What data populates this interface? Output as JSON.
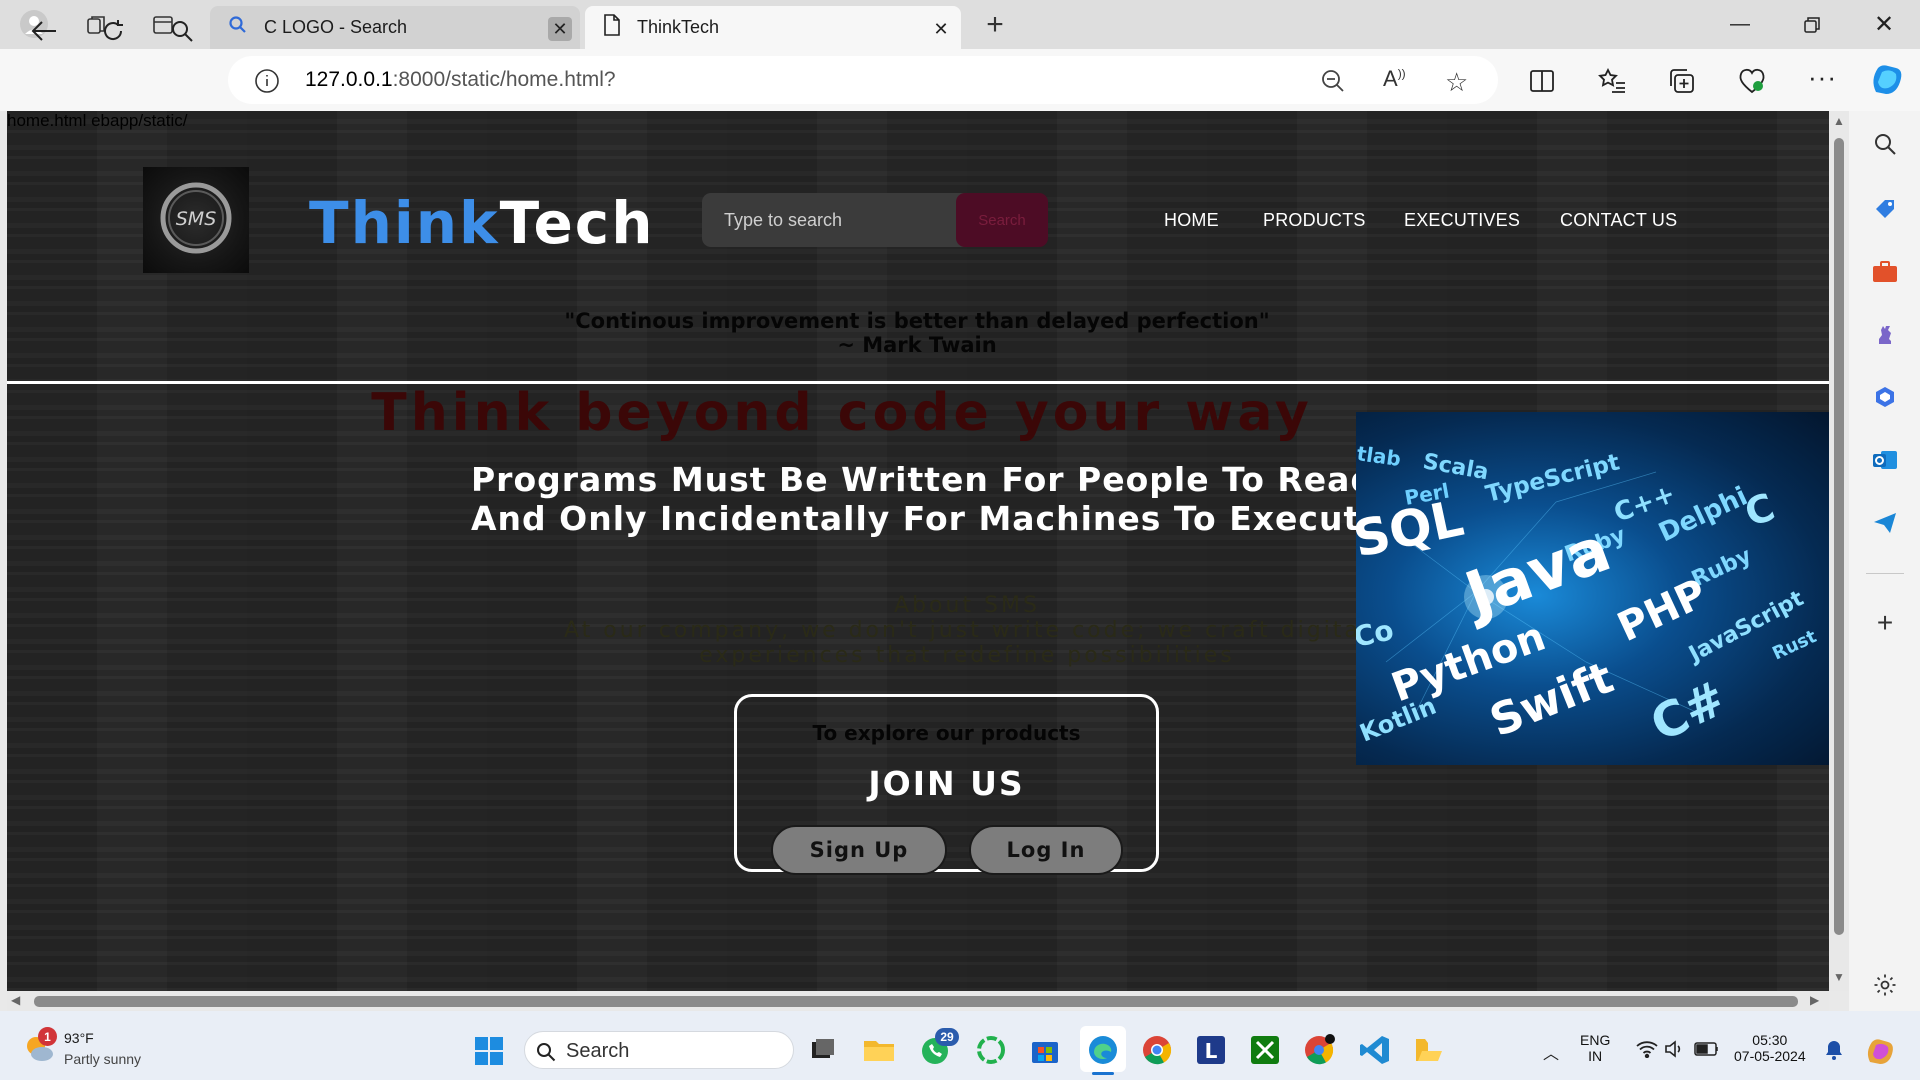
{
  "browser": {
    "tabs": [
      {
        "title": "C LOGO - Search",
        "active": false
      },
      {
        "title": "ThinkTech",
        "active": true
      }
    ],
    "url_host": "127.0.0.1",
    "url_rest": ":8000/static/home.html?"
  },
  "page": {
    "broken_image_alt": "home.html ebapp/static/",
    "logo_text": "SMS",
    "brand_think": "Think",
    "brand_tech": "Tech",
    "search_placeholder": "Type to search",
    "search_button": "Search",
    "menu": [
      "HOME",
      "PRODUCTS",
      "EXECUTIVES",
      "CONTACT US"
    ],
    "quote_line1": "\"Continous improvement is better than delayed perfection\"",
    "quote_line2": "~ Mark Twain",
    "tagline": "Think beyond code your way",
    "programs_line1": "Programs Must Be Written For People To Read,",
    "programs_line2": "And Only Incidentally For Machines To Execute",
    "about_title": "About SMS",
    "about_line1": "At our company, we don't just write code; we craft digital",
    "about_line2": "experiences that redefine possibilities",
    "explore": "To explore our products",
    "join_title": "JOIN US",
    "signup": "Sign Up",
    "login": "Log In",
    "hero_words": [
      "tlab",
      "Scala",
      "Perl",
      "TypeScript",
      "C++",
      "SQL",
      "Ruby",
      "Delphi",
      "C",
      "Java",
      "Ruby",
      "PHP",
      "Co",
      "Python",
      "JavaScript",
      "Rust",
      "Kotlin",
      "Swift",
      "C#"
    ]
  },
  "taskbar": {
    "weather_badge": "1",
    "weather_temp": "93°F",
    "weather_cond": "Partly sunny",
    "search_label": "Search",
    "whatsapp_badge": "29",
    "lang_top": "ENG",
    "lang_bottom": "IN",
    "time": "05:30",
    "date": "07-05-2024"
  },
  "colors": {
    "think": "#3d8ee8",
    "search_btn": "#4d0c25",
    "tagline": "#3b0707"
  }
}
